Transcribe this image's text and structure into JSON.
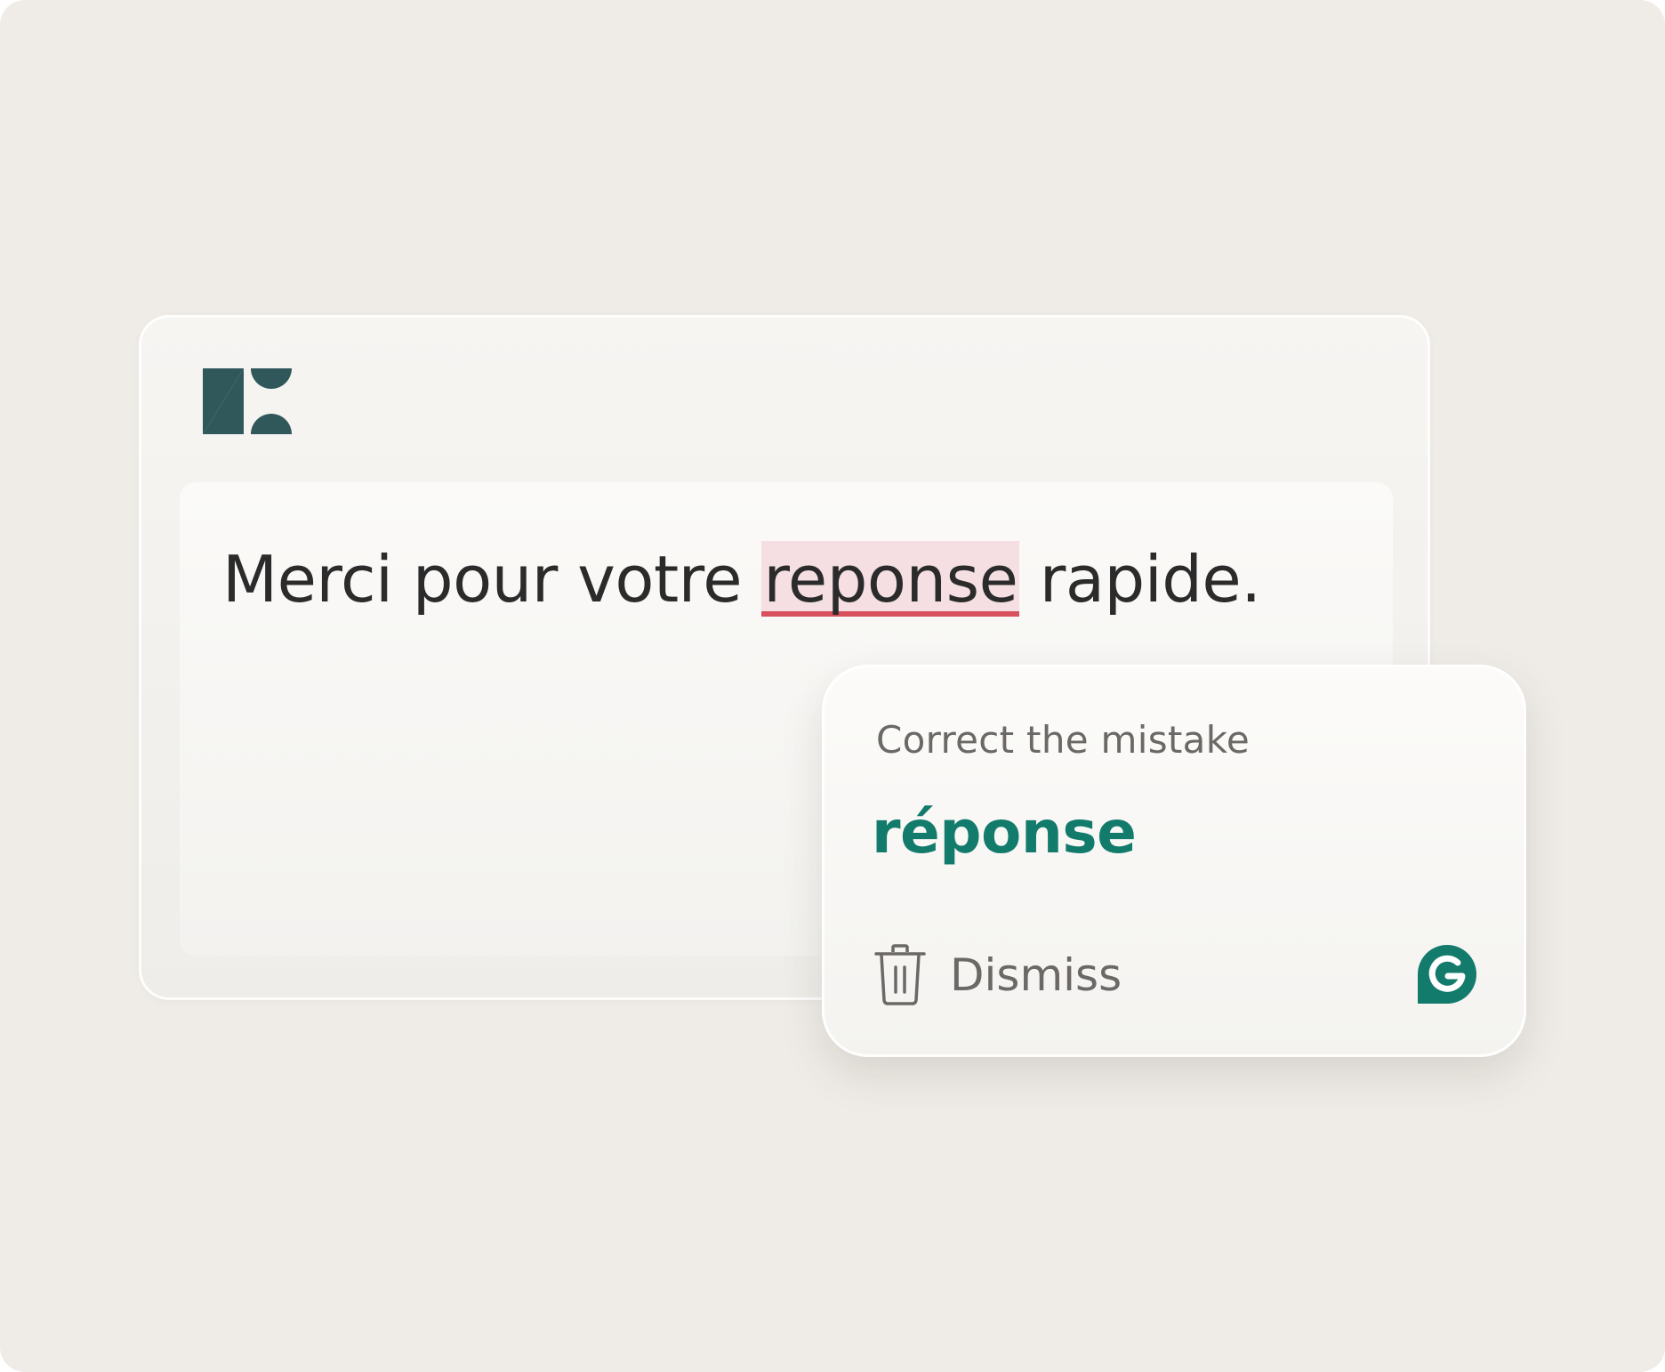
{
  "editor": {
    "logo_icon": "zendesk-logo-icon",
    "message": {
      "before": "Merci pour votre ",
      "flagged": "reponse",
      "after": " rapide."
    }
  },
  "suggestion": {
    "heading": "Correct the mistake",
    "replacement": "réponse",
    "dismiss_label": "Dismiss",
    "dismiss_icon": "trash-icon",
    "brand_icon": "grammarly-icon"
  },
  "colors": {
    "background": "#efece7",
    "brand_logo": "#30575a",
    "flag_highlight": "#f5dfe2",
    "flag_underline": "#d9505d",
    "suggestion_accent": "#137b6b",
    "muted_text": "#6b6866"
  }
}
